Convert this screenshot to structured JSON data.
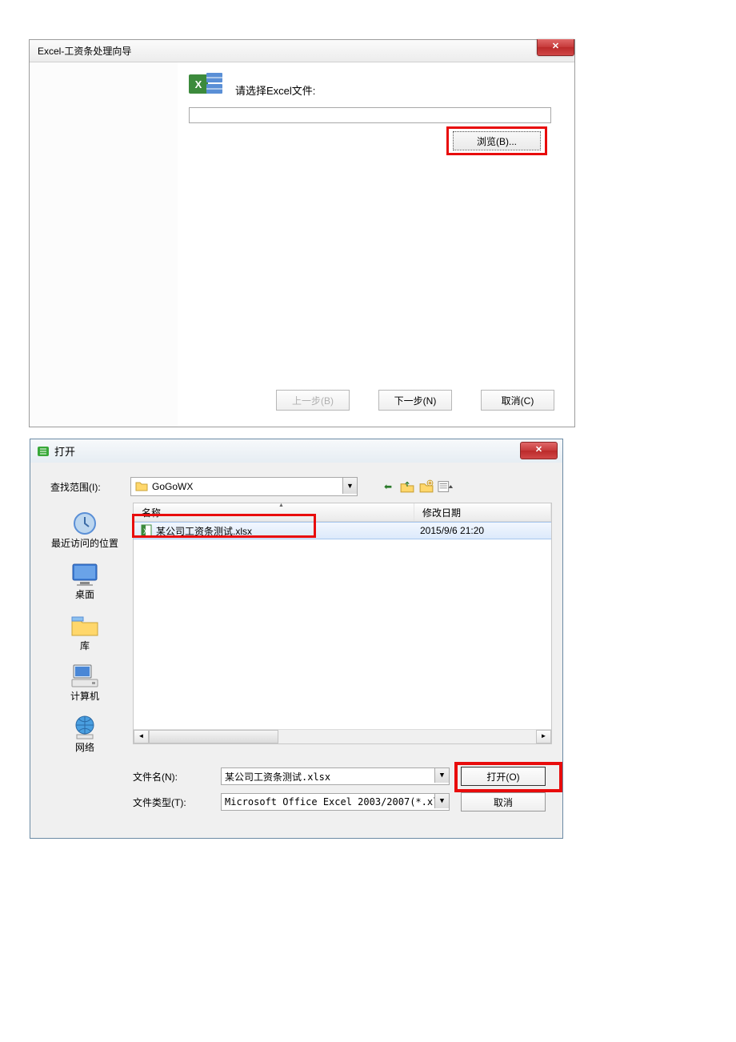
{
  "wizard": {
    "title": "Excel-工资条处理向导",
    "prompt": "请选择Excel文件:",
    "file_path": "",
    "browse_label": "浏览(B)...",
    "prev_label": "上一步(B)",
    "next_label": "下一步(N)",
    "cancel_label": "取消(C)"
  },
  "open": {
    "title": "打开",
    "lookin_label": "查找范围(I):",
    "lookin_folder": "GoGoWX",
    "places": [
      {
        "label": "最近访问的位置"
      },
      {
        "label": "桌面"
      },
      {
        "label": "库"
      },
      {
        "label": "计算机"
      },
      {
        "label": "网络"
      }
    ],
    "columns": {
      "name": "名称",
      "date": "修改日期"
    },
    "files": [
      {
        "name": "某公司工资条测试.xlsx",
        "date": "2015/9/6 21:20",
        "selected": true
      }
    ],
    "filename_label": "文件名(N):",
    "filename_value": "某公司工资条测试.xlsx",
    "filetype_label": "文件类型(T):",
    "filetype_value": "Microsoft Office Excel 2003/2007(*.xl",
    "open_label": "打开(O)",
    "cancel_label": "取消"
  }
}
